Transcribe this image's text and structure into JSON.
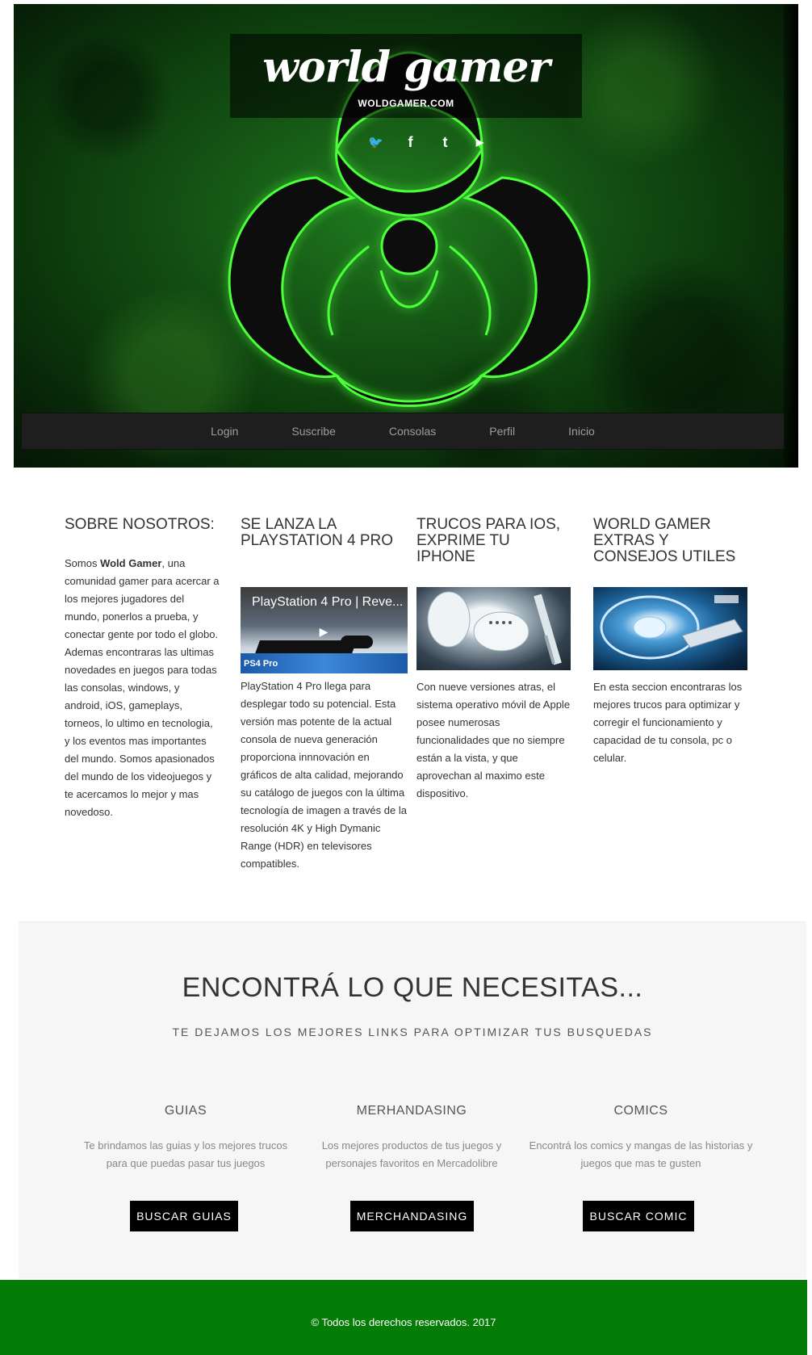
{
  "header": {
    "title": "world gamer",
    "subtitle": "WOLDGAMER.COM",
    "social": [
      {
        "icon": "twitter-icon",
        "glyph": "🐦"
      },
      {
        "icon": "facebook-icon",
        "glyph": "f"
      },
      {
        "icon": "tumblr-icon",
        "glyph": "t"
      },
      {
        "icon": "youtube-icon",
        "glyph": "▶"
      }
    ]
  },
  "nav": {
    "items": [
      "Login",
      "Suscribe",
      "Consolas",
      "Perfil",
      "Inicio"
    ]
  },
  "articles": {
    "about": {
      "title": "SOBRE NOSOTROS:",
      "text_pre": "Somos ",
      "text_bold": "Wold Gamer",
      "text_post": ", una comunidad gamer para acercar a los mejores jugadores del mundo, ponerlos a prueba, y conectar gente por todo el globo. Ademas encontraras las ultimas novedades en juegos para todas las consolas, windows, y android, iOS, gameplays, torneos, lo ultimo en tecnologia, y los eventos mas importantes del mundo. Somos apasionados del mundo de los videojuegos y te acercamos lo mejor y mas novedoso."
    },
    "ps4": {
      "title": "SE LANZA LA PLAYSTATION 4 PRO",
      "video_title": "PlayStation 4 Pro | Reve...",
      "video_logo": "PS4 Pro",
      "text": "PlayStation 4 Pro llega para desplegar todo su potencial. Esta versión mas potente de la actual consola de nueva generación proporciona innnovación en gráficos de alta calidad, mejorando su catálogo de juegos con la última tecnología de imagen a través de la resolución 4K y High Dymanic Range (HDR) en televisores compatibles."
    },
    "ios": {
      "title": "TRUCOS PARA IOS, EXPRIME TU IPHONE",
      "text": "Con nueve versiones atras, el sistema operativo móvil de Apple posee numerosas funcionalidades que no siempre están a la vista, y que aprovechan al maximo este dispositivo."
    },
    "extras": {
      "title": "WORLD GAMER EXTRAS Y CONSEJOS UTILES",
      "text": "En esta seccion encontraras los mejores trucos para optimizar y corregir el funcionamiento y capacidad de tu consola, pc o celular."
    }
  },
  "find": {
    "title": "ENCONTRÁ LO QUE NECESITAS...",
    "subtitle": "TE DEJAMOS LOS MEJORES LINKS PARA OPTIMIZAR TUS BUSQUEDAS",
    "columns": [
      {
        "heading": "GUIAS",
        "text": "Te brindamos las guias y los mejores trucos para que puedas pasar tus juegos",
        "button": "BUSCAR GUIAS"
      },
      {
        "heading": "MERHANDASING",
        "text": "Los mejores productos de tus juegos y personajes favoritos en Mercadolibre",
        "button": "MERCHANDASING"
      },
      {
        "heading": "COMICS",
        "text": "Encontrá los comics y mangas de las historias y juegos que mas te gusten",
        "button": "BUSCAR COMIC"
      }
    ]
  },
  "footer": {
    "text": "© Todos los derechos reservados. 2017"
  }
}
